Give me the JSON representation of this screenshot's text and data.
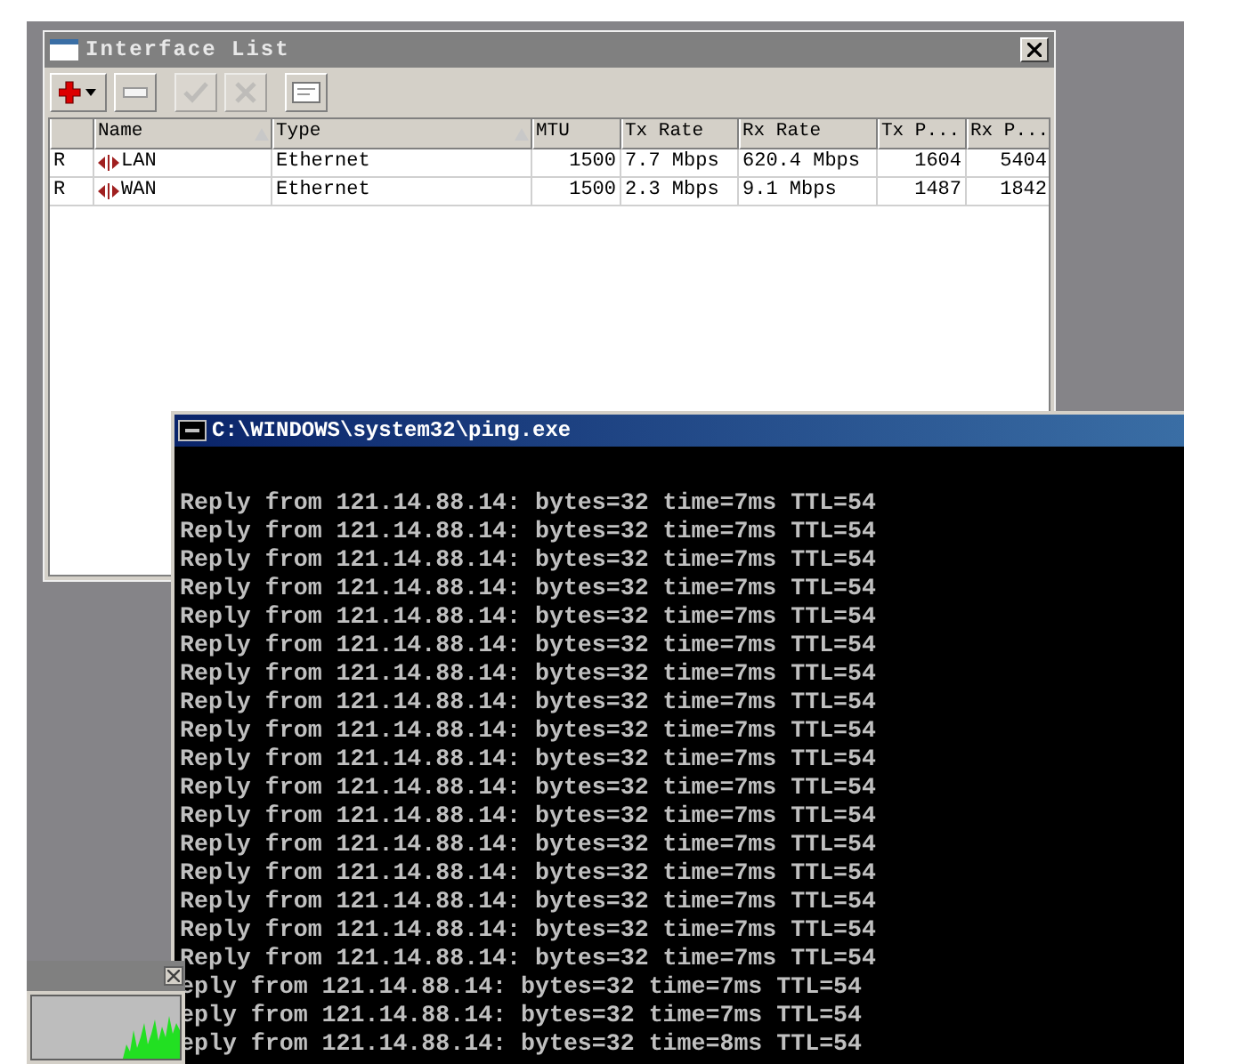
{
  "interface_window": {
    "title": "Interface List",
    "toolbar": [
      {
        "kind": "add",
        "disabled": false
      },
      {
        "kind": "remove",
        "disabled": false
      },
      {
        "kind": "enable",
        "disabled": true
      },
      {
        "kind": "disable",
        "disabled": true
      },
      {
        "kind": "comment",
        "disabled": false
      }
    ],
    "columns": [
      {},
      {
        "label": "Name",
        "sort_icon": true
      },
      {
        "label": "Type",
        "sort_icon": true
      },
      {
        "label": "MTU"
      },
      {
        "label": "Tx Rate"
      },
      {
        "label": "Rx Rate"
      },
      {
        "label": "Tx P..."
      },
      {
        "label": "Rx P..."
      }
    ],
    "rows": [
      {
        "flag": "R",
        "name": "LAN",
        "type": "Ethernet",
        "mtu": "1500",
        "tx_rate": "7.7 Mbps",
        "rx_rate": "620.4 Mbps",
        "tx_packets": "1604",
        "rx_packets": "5404"
      },
      {
        "flag": "R",
        "name": "WAN",
        "type": "Ethernet",
        "mtu": "1500",
        "tx_rate": "2.3 Mbps",
        "rx_rate": "9.1 Mbps",
        "tx_packets": "1487",
        "rx_packets": "1842"
      }
    ]
  },
  "console": {
    "title": "C:\\WINDOWS\\system32\\ping.exe",
    "lines": [
      "Reply from 121.14.88.14: bytes=32 time=7ms TTL=54",
      "Reply from 121.14.88.14: bytes=32 time=7ms TTL=54",
      "Reply from 121.14.88.14: bytes=32 time=7ms TTL=54",
      "Reply from 121.14.88.14: bytes=32 time=7ms TTL=54",
      "Reply from 121.14.88.14: bytes=32 time=7ms TTL=54",
      "Reply from 121.14.88.14: bytes=32 time=7ms TTL=54",
      "Reply from 121.14.88.14: bytes=32 time=7ms TTL=54",
      "Reply from 121.14.88.14: bytes=32 time=7ms TTL=54",
      "Reply from 121.14.88.14: bytes=32 time=7ms TTL=54",
      "Reply from 121.14.88.14: bytes=32 time=7ms TTL=54",
      "Reply from 121.14.88.14: bytes=32 time=7ms TTL=54",
      "Reply from 121.14.88.14: bytes=32 time=7ms TTL=54",
      "Reply from 121.14.88.14: bytes=32 time=7ms TTL=54",
      "Reply from 121.14.88.14: bytes=32 time=7ms TTL=54",
      "Reply from 121.14.88.14: bytes=32 time=7ms TTL=54",
      "Reply from 121.14.88.14: bytes=32 time=7ms TTL=54",
      "Reply from 121.14.88.14: bytes=32 time=7ms TTL=54",
      "eply from 121.14.88.14: bytes=32 time=7ms TTL=54",
      "eply from 121.14.88.14: bytes=32 time=7ms TTL=54",
      "eply from 121.14.88.14: bytes=32 time=8ms TTL=54"
    ]
  }
}
